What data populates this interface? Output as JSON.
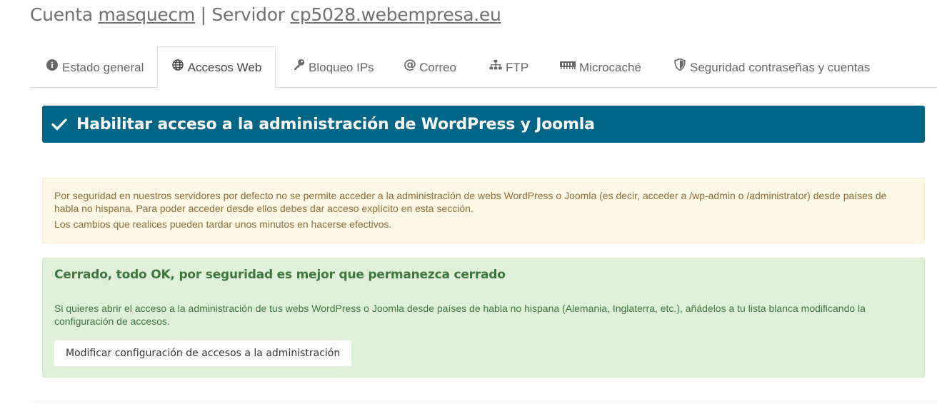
{
  "header": {
    "account_prefix": "Cuenta ",
    "account_name": "masquecm",
    "separator": " | Servidor ",
    "server_name": "cp5028.webempresa.eu"
  },
  "tabs": [
    {
      "label": "Estado general",
      "icon": "info-circle-icon",
      "active": false
    },
    {
      "label": "Accesos Web",
      "icon": "globe-icon",
      "active": true
    },
    {
      "label": "Bloqueo IPs",
      "icon": "key-icon",
      "active": false
    },
    {
      "label": "Correo",
      "icon": "at-sign-icon",
      "active": false
    },
    {
      "label": "FTP",
      "icon": "sitemap-icon",
      "active": false
    },
    {
      "label": "Microcaché",
      "icon": "memory-icon",
      "active": false
    },
    {
      "label": "Seguridad contraseñas y cuentas",
      "icon": "shield-icon",
      "active": false
    }
  ],
  "banner": {
    "title": "Habilitar acceso a la administración de WordPress y Joomla",
    "icon": "check-icon",
    "color": "#006688"
  },
  "warning": {
    "line1": "Por seguridad en nuestros servidores por defecto no se permite acceder a la administración de webs WordPress o Joomla (es decir, acceder a /wp-admin o /administrator) desde países de habla no hispana. Para poder acceder desde ellos debes dar acceso explícito en esta sección.",
    "line2": "Los cambios que realices pueden tardar unos minutos en hacerse efectivos."
  },
  "status": {
    "title": "Cerrado, todo OK, por seguridad es mejor que permanezca cerrado",
    "description": "Si quieres abrir el acceso a la administración de tus webs WordPress o Joomla desde países de habla no hispana (Alemania, Inglaterra, etc.), añádelos a tu lista blanca modificando la configuración de accesos.",
    "button_label": "Modificar configuración de accesos a la administración"
  }
}
